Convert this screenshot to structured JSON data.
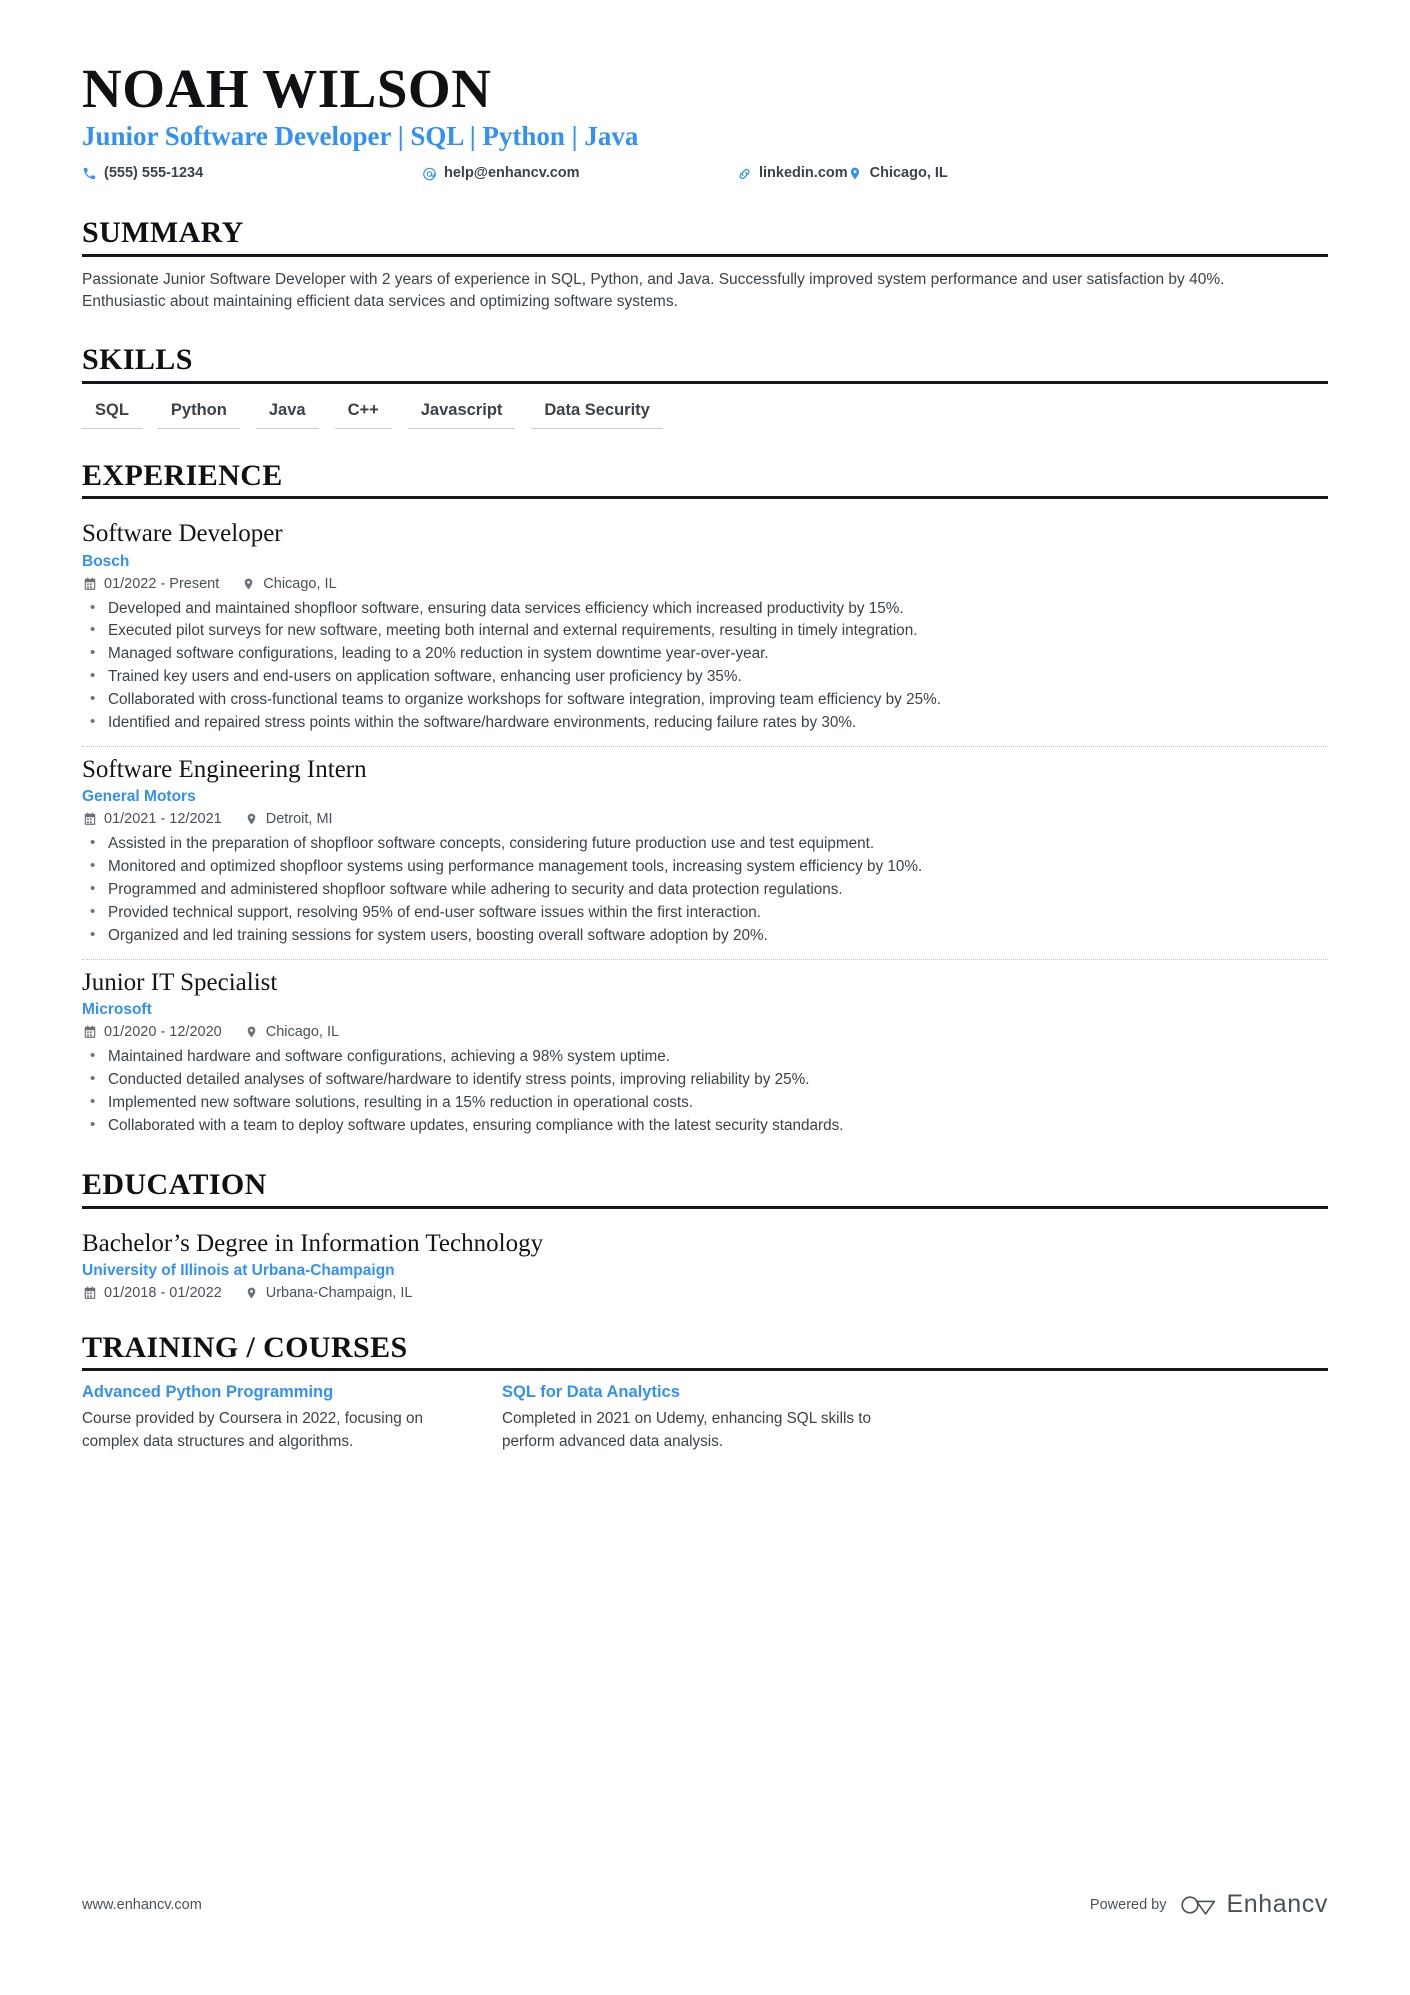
{
  "colors": {
    "accent": "#3291f6",
    "text": "#3b4248",
    "heading": "#0f1115",
    "rule": "#15181c",
    "divider": "#c3c7cc"
  },
  "header": {
    "name": "NOAH WILSON",
    "headline": "Junior Software Developer | SQL | Python | Java",
    "contacts": [
      {
        "icon": "phone-icon",
        "value": "(555) 555-1234"
      },
      {
        "icon": "email-icon",
        "value": "help@enhancv.com"
      },
      {
        "icon": "link-icon",
        "value": "linkedin.com"
      },
      {
        "icon": "location-icon",
        "value": "Chicago, IL"
      }
    ]
  },
  "summary": {
    "title": "SUMMARY",
    "text": "Passionate Junior Software Developer with 2 years of experience in SQL, Python, and Java. Successfully improved system performance and user satisfaction by 40%. Enthusiastic about maintaining efficient data services and optimizing software systems."
  },
  "skills": {
    "title": "SKILLS",
    "items": [
      "SQL",
      "Python",
      "Java",
      "C++",
      "Javascript",
      "Data Security"
    ]
  },
  "experience": {
    "title": "EXPERIENCE",
    "entries": [
      {
        "role": "Software Developer",
        "company": "Bosch",
        "dates": "01/2022 - Present",
        "location": "Chicago, IL",
        "bullets": [
          "Developed and maintained shopfloor software, ensuring data services efficiency which increased productivity by 15%.",
          "Executed pilot surveys for new software, meeting both internal and external requirements, resulting in timely integration.",
          "Managed software configurations, leading to a 20% reduction in system downtime year-over-year.",
          "Trained key users and end-users on application software, enhancing user proficiency by 35%.",
          "Collaborated with cross-functional teams to organize workshops for software integration, improving team efficiency by 25%.",
          "Identified and repaired stress points within the software/hardware environments, reducing failure rates by 30%."
        ]
      },
      {
        "role": "Software Engineering Intern",
        "company": "General Motors",
        "dates": "01/2021 - 12/2021",
        "location": "Detroit, MI",
        "bullets": [
          "Assisted in the preparation of shopfloor software concepts, considering future production use and test equipment.",
          "Monitored and optimized shopfloor systems using performance management tools, increasing system efficiency by 10%.",
          "Programmed and administered shopfloor software while adhering to security and data protection regulations.",
          "Provided technical support, resolving 95% of end-user software issues within the first interaction.",
          "Organized and led training sessions for system users, boosting overall software adoption by 20%."
        ]
      },
      {
        "role": "Junior IT Specialist",
        "company": "Microsoft",
        "dates": "01/2020 - 12/2020",
        "location": "Chicago, IL",
        "bullets": [
          "Maintained hardware and software configurations, achieving a 98% system uptime.",
          "Conducted detailed analyses of software/hardware to identify stress points, improving reliability by 25%.",
          "Implemented new software solutions, resulting in a 15% reduction in operational costs.",
          "Collaborated with a team to deploy software updates, ensuring compliance with the latest security standards."
        ]
      }
    ]
  },
  "education": {
    "title": "EDUCATION",
    "entries": [
      {
        "degree": "Bachelor’s Degree in Information Technology",
        "school": "University of Illinois at Urbana-Champaign",
        "dates": "01/2018 - 01/2022",
        "location": "Urbana-Champaign, IL"
      }
    ]
  },
  "training": {
    "title": "TRAINING / COURSES",
    "courses": [
      {
        "name": "Advanced Python Programming",
        "description": "Course provided by Coursera in 2022, focusing on complex data structures and algorithms."
      },
      {
        "name": "SQL for Data Analytics",
        "description": "Completed in 2021 on Udemy, enhancing SQL skills to perform advanced data analysis."
      }
    ]
  },
  "footer": {
    "url": "www.enhancv.com",
    "powered_by": "Powered by",
    "brand": "Enhancv"
  }
}
